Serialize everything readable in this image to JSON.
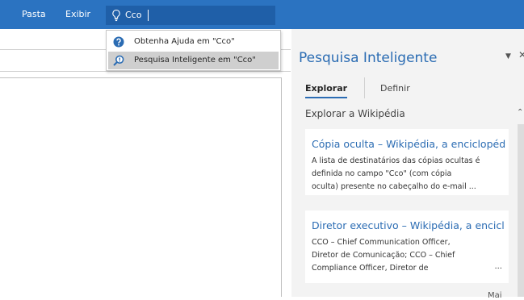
{
  "menu": {
    "items": [
      {
        "label": "Pasta"
      },
      {
        "label": "Exibir"
      }
    ]
  },
  "tell_me": {
    "value": "Cco",
    "icon": "lightbulb-icon"
  },
  "dropdown": {
    "items": [
      {
        "label": "Obtenha Ajuda em \"Cco\"",
        "icon": "help-circle-icon"
      },
      {
        "label": "Pesquisa Inteligente em \"Cco\"",
        "icon": "smart-lookup-icon",
        "selected": true
      }
    ]
  },
  "smart_pane": {
    "title": "Pesquisa Inteligente",
    "tabs": [
      {
        "label": "Explorar",
        "active": true
      },
      {
        "label": "Definir",
        "active": false
      }
    ],
    "section_heading": "Explorar a Wikipédia",
    "cards": [
      {
        "title": "Cópia oculta – Wikipédia, a enciclopéd",
        "lines": [
          "A lista de destinatários das cópias ocultas é",
          "definida no campo \"Cco\" (com cópia",
          "oculta) presente no cabeçalho do e-mail ..."
        ]
      },
      {
        "title": "Diretor executivo – Wikipédia, a encicl",
        "lines": [
          "CCO – Chief Communication Officer,",
          "Diretor de Comunicação; CCO – Chief",
          "Compliance Officer, Diretor de"
        ],
        "ellipsis": "..."
      }
    ],
    "more_label": "Mai"
  },
  "colors": {
    "ribbon": "#2b73c1",
    "accent": "#2b6cb3",
    "pane_bg": "#f3f3f3"
  }
}
